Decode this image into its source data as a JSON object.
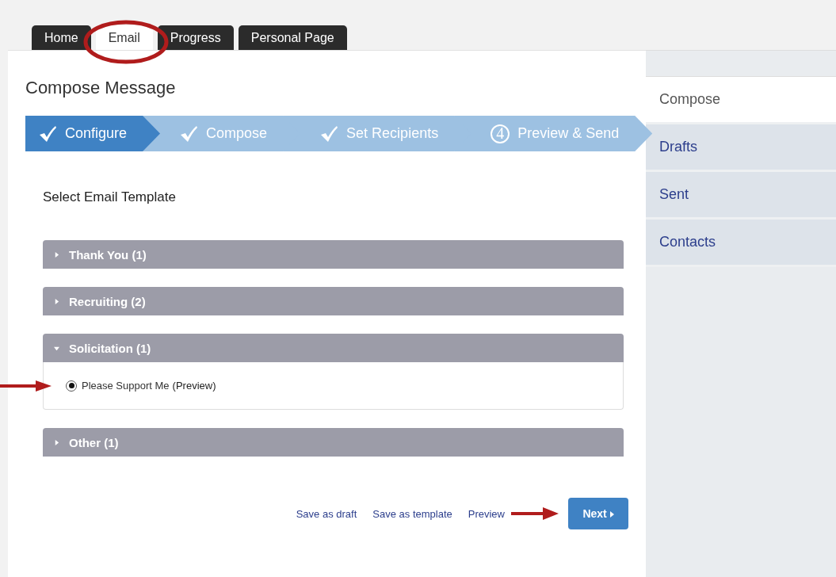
{
  "tabs": [
    {
      "label": "Home",
      "selected": false
    },
    {
      "label": "Email",
      "selected": true
    },
    {
      "label": "Progress",
      "selected": false
    },
    {
      "label": "Personal Page",
      "selected": false
    }
  ],
  "title": "Compose Message",
  "steps": [
    {
      "label": "Configure",
      "kind": "check",
      "selected": true
    },
    {
      "label": "Compose",
      "kind": "check",
      "selected": false
    },
    {
      "label": "Set Recipients",
      "kind": "check",
      "selected": false
    },
    {
      "label": "Preview & Send",
      "kind": "number",
      "number": "4",
      "selected": false
    }
  ],
  "section_label": "Select Email Template",
  "groups": [
    {
      "label": "Thank You (1)",
      "expanded": false
    },
    {
      "label": "Recruiting (2)",
      "expanded": false
    },
    {
      "label": "Solicitation (1)",
      "expanded": true,
      "options": [
        {
          "label": "Please Support Me",
          "link": "(Preview)",
          "selected": true
        }
      ]
    },
    {
      "label": "Other (1)",
      "expanded": false
    }
  ],
  "actions": [
    "Save as draft",
    "Save as template",
    "Preview"
  ],
  "next_button": "Next",
  "sidebar": [
    {
      "label": "Compose",
      "selected": true
    },
    {
      "label": "Drafts",
      "selected": false
    },
    {
      "label": "Sent",
      "selected": false
    },
    {
      "label": "Contacts",
      "selected": false
    }
  ]
}
